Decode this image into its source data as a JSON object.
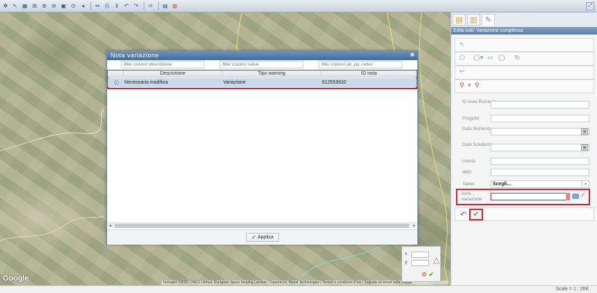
{
  "toolbar": {
    "icons": [
      "pan-icon",
      "zoom-in-icon",
      "zoom-out-icon",
      "zoom-box-icon",
      "zoom-extent-icon",
      "prev-view-icon",
      "next-view-icon",
      "measure-icon",
      "info-icon",
      "refresh-icon",
      "print-icon",
      "export-icon"
    ],
    "right_icon": "expand-icon"
  },
  "map": {
    "google_label": "Google",
    "attribution": "Immagini ©2020, CNES / Airbus, European Space Imaging,Landsat / Copernicus, Maxar Technologies | Termini e condizioni d'uso | Segnala un errore nella mappa"
  },
  "coord_panel": {
    "x_label": "x",
    "y_label": "y"
  },
  "dialog": {
    "title": "Nota variazione",
    "filters": {
      "descrizione": "filter column descrizione",
      "value": "filter column value",
      "notes": "filter column pk_pq_notes"
    },
    "columns": [
      "Descrizione",
      "Tipo warning",
      "ID nota"
    ],
    "rows": [
      {
        "descrizione": "Necessaria modifica",
        "tipo": "Variazione",
        "id": "612553632"
      }
    ],
    "apply_label": "Applica"
  },
  "panel": {
    "header": "Edita tutti: Variazione complessa",
    "fields": {
      "id_area": "ID Area Richiesta",
      "progetto": "Progetto",
      "data_richiesta": "Data Richiesta",
      "data_scadenza": "Data Scadenza",
      "utente": "Utente",
      "imei": "IMEI",
      "tablet": "Tablet",
      "nota": "Nota variazione"
    },
    "tablet_value": "Scegli..."
  },
  "status": {
    "scale": "Scale = 1 : 26K"
  },
  "colors": {
    "highlight": "#d8202f",
    "header_blue": "#5b80ad",
    "row_selected": "#c9d9ee"
  }
}
